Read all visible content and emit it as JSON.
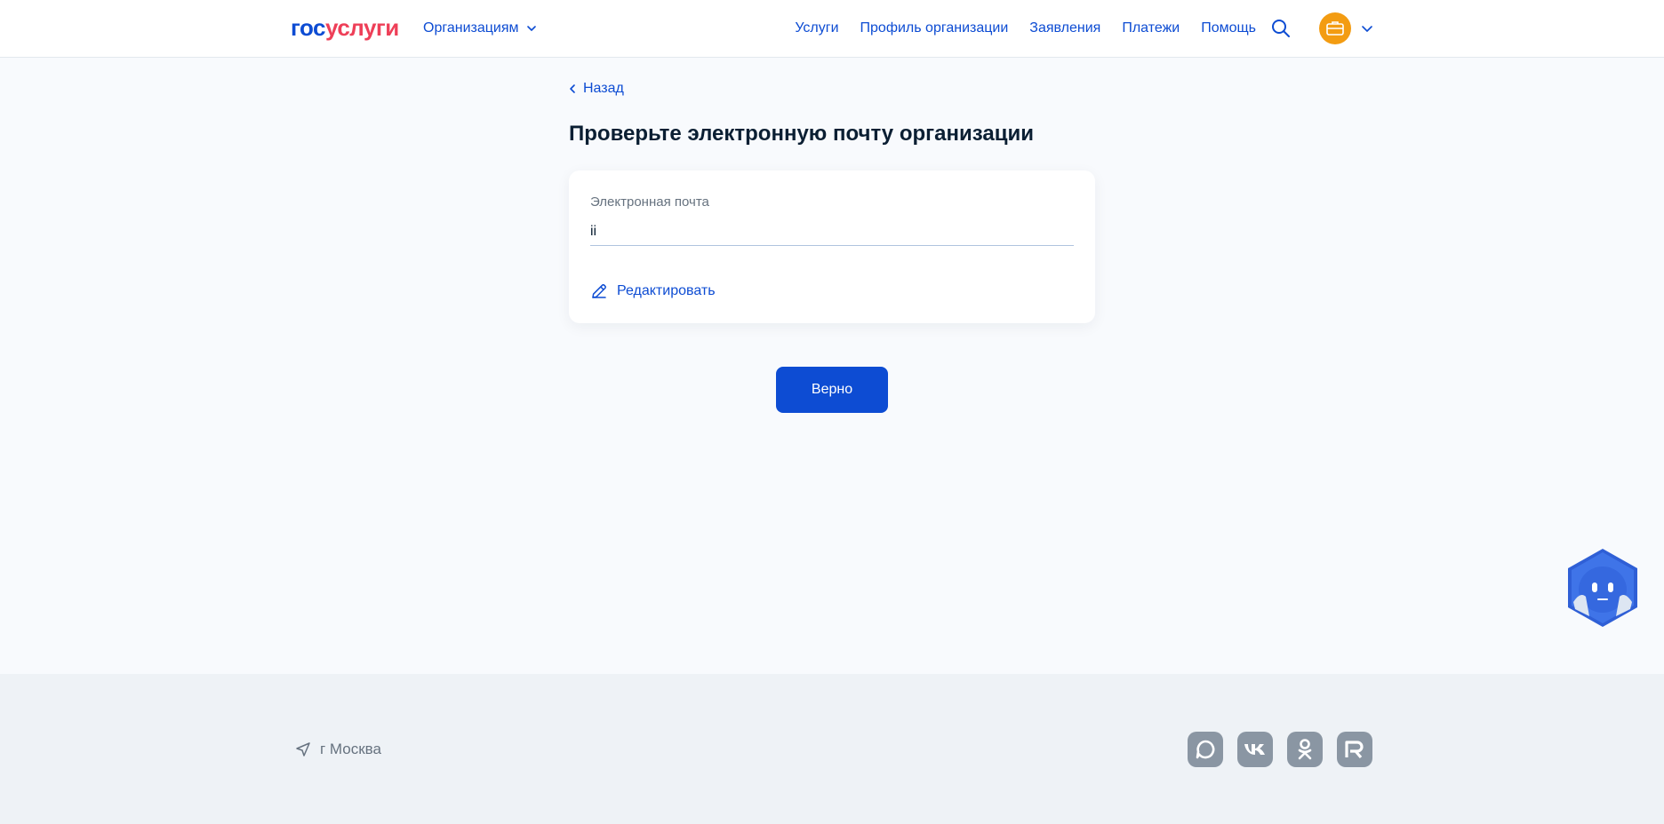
{
  "header": {
    "logo_part1": "гос",
    "logo_part2": "услуги",
    "org_menu_label": "Организациям",
    "nav": [
      "Услуги",
      "Профиль организации",
      "Заявления",
      "Платежи",
      "Помощь"
    ]
  },
  "main": {
    "back_label": "Назад",
    "title": "Проверьте электронную почту организации",
    "email_label": "Электронная почта",
    "email_value": "ii",
    "edit_label": "Редактировать",
    "confirm_label": "Верно"
  },
  "footer": {
    "location": "г Москва",
    "socials": [
      "max-icon",
      "vk-icon",
      "ok-icon",
      "rutube-icon"
    ]
  },
  "colors": {
    "accent": "#0d4cd3",
    "logo_red": "#ee3f58",
    "avatar": "#f39c12",
    "social_bg": "#8a96a3"
  }
}
